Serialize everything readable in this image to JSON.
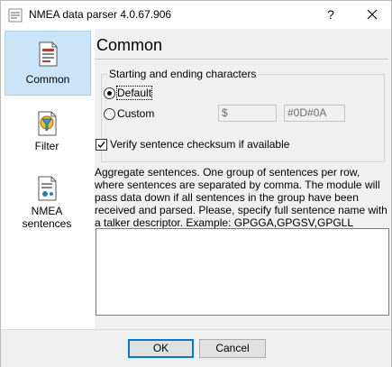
{
  "window": {
    "title": "NMEA data parser 4.0.67.906",
    "help_label": "?"
  },
  "sidebar": {
    "items": [
      {
        "label": "Common",
        "icon": "document-icon"
      },
      {
        "label": "Filter",
        "icon": "filter-icon"
      },
      {
        "label_line1": "NMEA",
        "label_line2": "sentences",
        "icon": "sentences-icon"
      }
    ]
  },
  "main": {
    "title": "Common",
    "group": {
      "legend": "Starting and ending characters",
      "default_label": "Default",
      "custom_label": "Custom",
      "start_value": "$",
      "end_value": "#0D#0A",
      "selected": "Default"
    },
    "verify_checkbox": {
      "label": "Verify sentence checksum if available",
      "checked": true
    },
    "description": "Aggregate sentences. One group of sentences per row, where sentences are separated by comma. The module will pass data down if all sentences in the group have been received and parsed. Please, specify full sentence name with a talker descriptor. Example: GPGGA,GPGSV,GPGLL",
    "aggregate_value": ""
  },
  "footer": {
    "ok_label": "OK",
    "cancel_label": "Cancel"
  },
  "colors": {
    "selection": "#cce4f7",
    "accent": "#0078d7",
    "panel": "#f0f0f0"
  }
}
